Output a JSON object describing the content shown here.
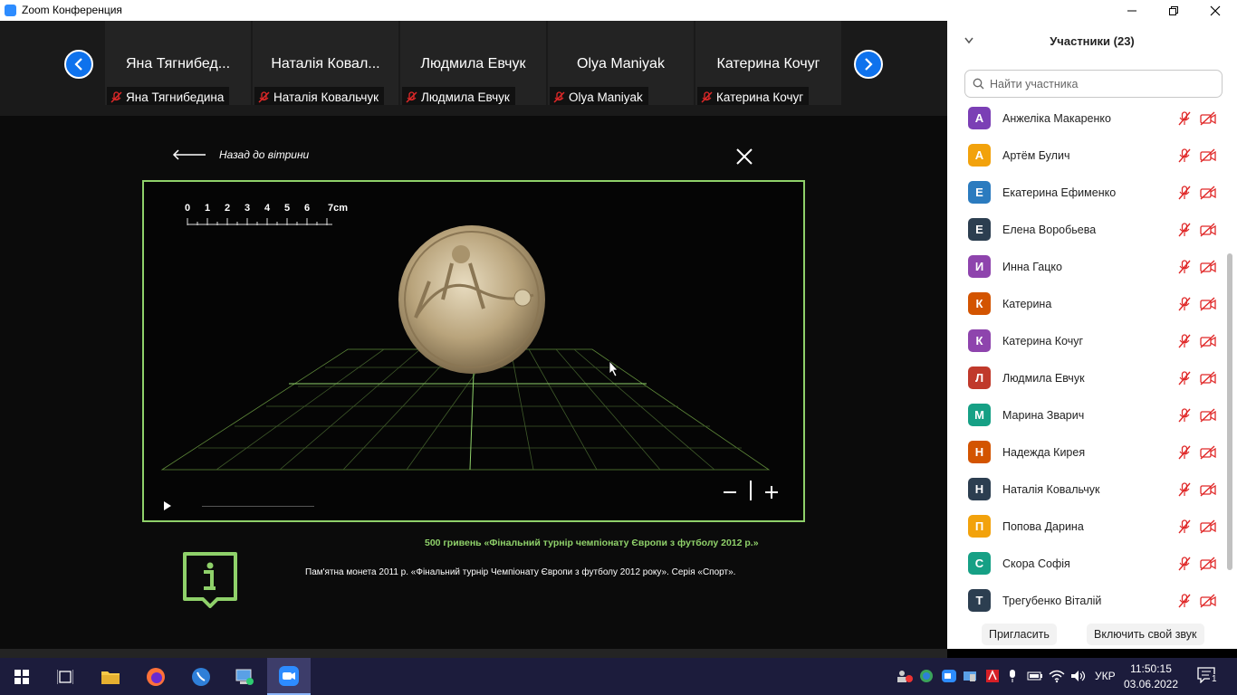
{
  "window": {
    "title": "Zoom Конференция"
  },
  "participants_strip": {
    "tiles": [
      {
        "display_name": "Яна  Тягнибед...",
        "label": "Яна Тягнибедина"
      },
      {
        "display_name": "Наталія Ковал...",
        "label": "Наталія Ковальчук"
      },
      {
        "display_name": "Людмила Евчук",
        "label": "Людмила Евчук"
      },
      {
        "display_name": "Olya Maniyak",
        "label": "Olya Maniyak"
      },
      {
        "display_name": "Катерина Кочуг",
        "label": "Катерина Кочуг"
      }
    ]
  },
  "viewer": {
    "back_label": "Назад до вітрини",
    "ruler_labels": [
      "0",
      "1",
      "2",
      "3",
      "4",
      "5",
      "6",
      "7cm"
    ],
    "progress": 0
  },
  "caption": {
    "title": "500 гривень «Фінальний турнір чемпіонату Європи з футболу 2012 р.»",
    "text": "Пам'ятна монета 2011 р. «Фінальний турнір Чемпіонату Європи з футболу 2012 року». Серія «Спорт»."
  },
  "panel": {
    "title": "Участники (23)",
    "search_placeholder": "Найти участника",
    "invite_label": "Пригласить",
    "unmute_label": "Включить свой звук",
    "participants": [
      {
        "initial": "А",
        "name": "Анжеліка Макаренко",
        "color": "#7b3fb5"
      },
      {
        "initial": "А",
        "name": "Артём Булич",
        "color": "#f2a20c"
      },
      {
        "initial": "Е",
        "name": "Екатерина Ефименко",
        "color": "#2b7bbf"
      },
      {
        "initial": "Е",
        "name": "Елена Воробьева",
        "color": "#2c3e50"
      },
      {
        "initial": "И",
        "name": "Инна Гацко",
        "color": "#8e44ad"
      },
      {
        "initial": "К",
        "name": "Катерина",
        "color": "#d35400"
      },
      {
        "initial": "К",
        "name": "Катерина Кочуг",
        "color": "#8e44ad"
      },
      {
        "initial": "Л",
        "name": "Людмила Евчук",
        "color": "#c0392b"
      },
      {
        "initial": "М",
        "name": "Марина Зварич",
        "color": "#16a085"
      },
      {
        "initial": "Н",
        "name": "Надежда Кирея",
        "color": "#d35400"
      },
      {
        "initial": "Н",
        "name": "Наталія Ковальчук",
        "color": "#2c3e50"
      },
      {
        "initial": "П",
        "name": "Попова Дарина",
        "color": "#f2a20c"
      },
      {
        "initial": "С",
        "name": "Скора Софія",
        "color": "#16a085"
      },
      {
        "initial": "Т",
        "name": "Трегубенко Віталій",
        "color": "#2c3e50"
      }
    ]
  },
  "taskbar": {
    "language": "УКР",
    "time": "11:50:15",
    "date": "03.06.2022",
    "notification_count": "1"
  }
}
